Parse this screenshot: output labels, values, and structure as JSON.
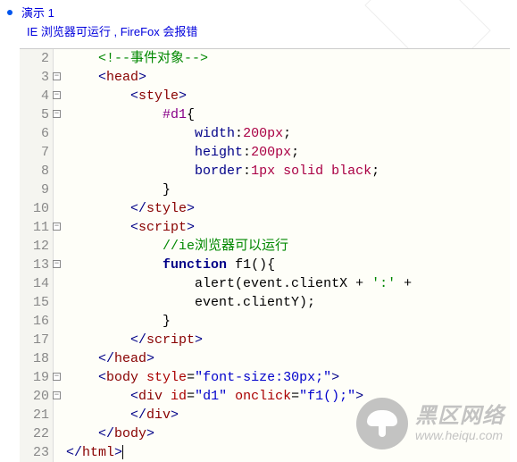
{
  "header": {
    "title": "演示 1",
    "subtitle": "IE 浏览器可运行 , FireFox 会报错"
  },
  "watermark": {
    "cn": "黑区网络",
    "url": "www.heiqu.com"
  },
  "code": {
    "lines": [
      {
        "num": "2",
        "fold": "",
        "tokens": [
          {
            "t": "    ",
            "c": ""
          },
          {
            "t": "<!--事件对象-->",
            "c": "comment"
          }
        ]
      },
      {
        "num": "3",
        "fold": "-",
        "tokens": [
          {
            "t": "    ",
            "c": ""
          },
          {
            "t": "<",
            "c": "tag-bracket"
          },
          {
            "t": "head",
            "c": "tag"
          },
          {
            "t": ">",
            "c": "tag-bracket"
          }
        ]
      },
      {
        "num": "4",
        "fold": "-",
        "tokens": [
          {
            "t": "        ",
            "c": ""
          },
          {
            "t": "<",
            "c": "tag-bracket"
          },
          {
            "t": "style",
            "c": "tag"
          },
          {
            "t": ">",
            "c": "tag-bracket"
          }
        ]
      },
      {
        "num": "5",
        "fold": "-",
        "tokens": [
          {
            "t": "            ",
            "c": ""
          },
          {
            "t": "#d1",
            "c": "css-sel"
          },
          {
            "t": "{",
            "c": "ident"
          }
        ]
      },
      {
        "num": "6",
        "fold": "",
        "tokens": [
          {
            "t": "                ",
            "c": ""
          },
          {
            "t": "width",
            "c": "css-prop"
          },
          {
            "t": ":",
            "c": "ident"
          },
          {
            "t": "200px",
            "c": "css-val"
          },
          {
            "t": ";",
            "c": "ident"
          }
        ]
      },
      {
        "num": "7",
        "fold": "",
        "tokens": [
          {
            "t": "                ",
            "c": ""
          },
          {
            "t": "height",
            "c": "css-prop"
          },
          {
            "t": ":",
            "c": "ident"
          },
          {
            "t": "200px",
            "c": "css-val"
          },
          {
            "t": ";",
            "c": "ident"
          }
        ]
      },
      {
        "num": "8",
        "fold": "",
        "tokens": [
          {
            "t": "                ",
            "c": ""
          },
          {
            "t": "border",
            "c": "css-prop"
          },
          {
            "t": ":",
            "c": "ident"
          },
          {
            "t": "1px solid black",
            "c": "css-val"
          },
          {
            "t": ";",
            "c": "ident"
          }
        ]
      },
      {
        "num": "9",
        "fold": "",
        "tokens": [
          {
            "t": "            ",
            "c": ""
          },
          {
            "t": "}",
            "c": "ident"
          }
        ]
      },
      {
        "num": "10",
        "fold": "",
        "tokens": [
          {
            "t": "        ",
            "c": ""
          },
          {
            "t": "</",
            "c": "tag-bracket"
          },
          {
            "t": "style",
            "c": "tag"
          },
          {
            "t": ">",
            "c": "tag-bracket"
          }
        ]
      },
      {
        "num": "11",
        "fold": "-",
        "tokens": [
          {
            "t": "        ",
            "c": ""
          },
          {
            "t": "<",
            "c": "tag-bracket"
          },
          {
            "t": "script",
            "c": "tag"
          },
          {
            "t": ">",
            "c": "tag-bracket"
          }
        ]
      },
      {
        "num": "12",
        "fold": "",
        "tokens": [
          {
            "t": "            ",
            "c": ""
          },
          {
            "t": "//ie浏览器可以运行",
            "c": "line-comment"
          }
        ]
      },
      {
        "num": "13",
        "fold": "-",
        "tokens": [
          {
            "t": "            ",
            "c": ""
          },
          {
            "t": "function",
            "c": "keyword"
          },
          {
            "t": " ",
            "c": ""
          },
          {
            "t": "f1",
            "c": "func"
          },
          {
            "t": "(){",
            "c": "ident"
          }
        ]
      },
      {
        "num": "14",
        "fold": "",
        "tokens": [
          {
            "t": "                ",
            "c": ""
          },
          {
            "t": "alert",
            "c": "func"
          },
          {
            "t": "(event.clientX + ",
            "c": "ident"
          },
          {
            "t": "':'",
            "c": "string"
          },
          {
            "t": " +",
            "c": "ident"
          }
        ]
      },
      {
        "num": "15",
        "fold": "",
        "tokens": [
          {
            "t": "                ",
            "c": ""
          },
          {
            "t": "event.clientY);",
            "c": "ident"
          }
        ]
      },
      {
        "num": "16",
        "fold": "",
        "tokens": [
          {
            "t": "            ",
            "c": ""
          },
          {
            "t": "}",
            "c": "ident"
          }
        ]
      },
      {
        "num": "17",
        "fold": "",
        "tokens": [
          {
            "t": "        ",
            "c": ""
          },
          {
            "t": "</",
            "c": "tag-bracket"
          },
          {
            "t": "script",
            "c": "tag"
          },
          {
            "t": ">",
            "c": "tag-bracket"
          }
        ]
      },
      {
        "num": "18",
        "fold": "",
        "tokens": [
          {
            "t": "    ",
            "c": ""
          },
          {
            "t": "</",
            "c": "tag-bracket"
          },
          {
            "t": "head",
            "c": "tag"
          },
          {
            "t": ">",
            "c": "tag-bracket"
          }
        ]
      },
      {
        "num": "19",
        "fold": "-",
        "tokens": [
          {
            "t": "    ",
            "c": ""
          },
          {
            "t": "<",
            "c": "tag-bracket"
          },
          {
            "t": "body ",
            "c": "tag"
          },
          {
            "t": "style",
            "c": "attr-name"
          },
          {
            "t": "=",
            "c": "ident"
          },
          {
            "t": "\"font-size:30px;\"",
            "c": "attr-val"
          },
          {
            "t": ">",
            "c": "tag-bracket"
          }
        ]
      },
      {
        "num": "20",
        "fold": "-",
        "tokens": [
          {
            "t": "        ",
            "c": ""
          },
          {
            "t": "<",
            "c": "tag-bracket"
          },
          {
            "t": "div ",
            "c": "tag"
          },
          {
            "t": "id",
            "c": "attr-name"
          },
          {
            "t": "=",
            "c": "ident"
          },
          {
            "t": "\"d1\"",
            "c": "attr-val"
          },
          {
            "t": " ",
            "c": ""
          },
          {
            "t": "onclick",
            "c": "attr-name"
          },
          {
            "t": "=",
            "c": "ident"
          },
          {
            "t": "\"f1();\"",
            "c": "attr-val"
          },
          {
            "t": ">",
            "c": "tag-bracket"
          }
        ]
      },
      {
        "num": "21",
        "fold": "",
        "tokens": [
          {
            "t": "        ",
            "c": ""
          },
          {
            "t": "</",
            "c": "tag-bracket"
          },
          {
            "t": "div",
            "c": "tag"
          },
          {
            "t": ">",
            "c": "tag-bracket"
          }
        ]
      },
      {
        "num": "22",
        "fold": "",
        "tokens": [
          {
            "t": "    ",
            "c": ""
          },
          {
            "t": "</",
            "c": "tag-bracket"
          },
          {
            "t": "body",
            "c": "tag"
          },
          {
            "t": ">",
            "c": "tag-bracket"
          }
        ]
      },
      {
        "num": "23",
        "fold": "",
        "tokens": [
          {
            "t": "</",
            "c": "tag-bracket"
          },
          {
            "t": "html",
            "c": "tag"
          },
          {
            "t": ">",
            "c": "tag-bracket"
          }
        ],
        "caret": true
      }
    ]
  }
}
